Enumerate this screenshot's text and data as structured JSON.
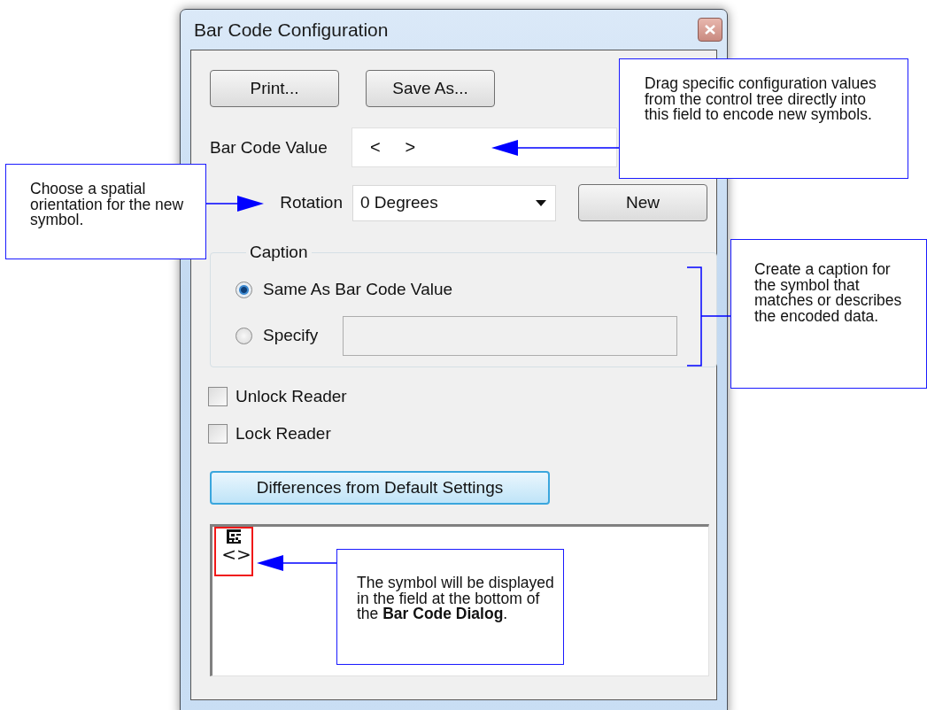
{
  "window": {
    "title": "Bar Code Configuration"
  },
  "buttons": [
    "Print...",
    "Save As..."
  ],
  "bar_code_value": {
    "label": "Bar Code Value",
    "value": "<     >"
  },
  "rotation": {
    "label": "Rotation",
    "value": "0 Degrees"
  },
  "new_button": "New",
  "caption": {
    "title": "Caption",
    "options": [
      {
        "label": "Same As Bar Code Value",
        "selected": true
      },
      {
        "label": "Specify",
        "selected": false
      }
    ]
  },
  "checkboxes": [
    {
      "label": "Unlock Reader",
      "checked": false
    },
    {
      "label": "Lock Reader",
      "checked": false
    }
  ],
  "differences_button": "Differences from Default Settings",
  "preview": {
    "symbol_text": "<>"
  },
  "callouts": [
    {
      "text": "Drag specific configuration values from the control tree directly into this field to encode new symbols."
    },
    {
      "text": "Choose a spatial orientation for the new symbol."
    },
    {
      "text": "Create a caption for the symbol that matches or describes the encoded data."
    },
    {
      "text": "The symbol will be displayed in the field at the bottom of the **Bar Code Dialog**."
    }
  ]
}
